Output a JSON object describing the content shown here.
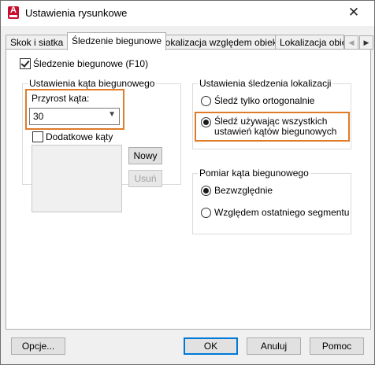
{
  "window": {
    "title": "Ustawienia rysunkowe",
    "close_symbol": "✕"
  },
  "tabs": [
    {
      "label": "Skok i siatka",
      "active": false
    },
    {
      "label": "Śledzenie biegunowe",
      "active": true
    },
    {
      "label": "Lokalizacja względem obiektu",
      "active": false
    },
    {
      "label": "Lokalizacja obiek",
      "active": false
    }
  ],
  "tab_scroll": {
    "left": "◀",
    "right": "▶"
  },
  "polar_tracking_checkbox": {
    "label": "Śledzenie biegunowe (F10)",
    "checked": true
  },
  "polar_angle_settings": {
    "legend": "Ustawienia kąta biegunowego",
    "increment_label": "Przyrost kąta:",
    "increment_value": "30",
    "additional_label": "Dodatkowe kąty",
    "additional_checked": false,
    "new_button": "Nowy",
    "delete_button": "Usuń"
  },
  "object_snap_tracking": {
    "legend": "Ustawienia śledzenia lokalizacji",
    "option_orthogonal": "Śledź tylko ortogonalnie",
    "option_all_line1": "Śledź używając wszystkich",
    "option_all_line2": "ustawień kątów biegunowych",
    "selected": "all"
  },
  "polar_angle_measurement": {
    "legend": "Pomiar kąta biegunowego",
    "option_absolute": "Bezwzględnie",
    "option_relative": "Względem ostatniego segmentu",
    "selected": "absolute"
  },
  "footer": {
    "options": "Opcje...",
    "ok": "OK",
    "cancel": "Anuluj",
    "help": "Pomoc"
  },
  "colors": {
    "highlight": "#e07b28",
    "accent": "#0078d7",
    "app_icon": "#c8102e"
  }
}
